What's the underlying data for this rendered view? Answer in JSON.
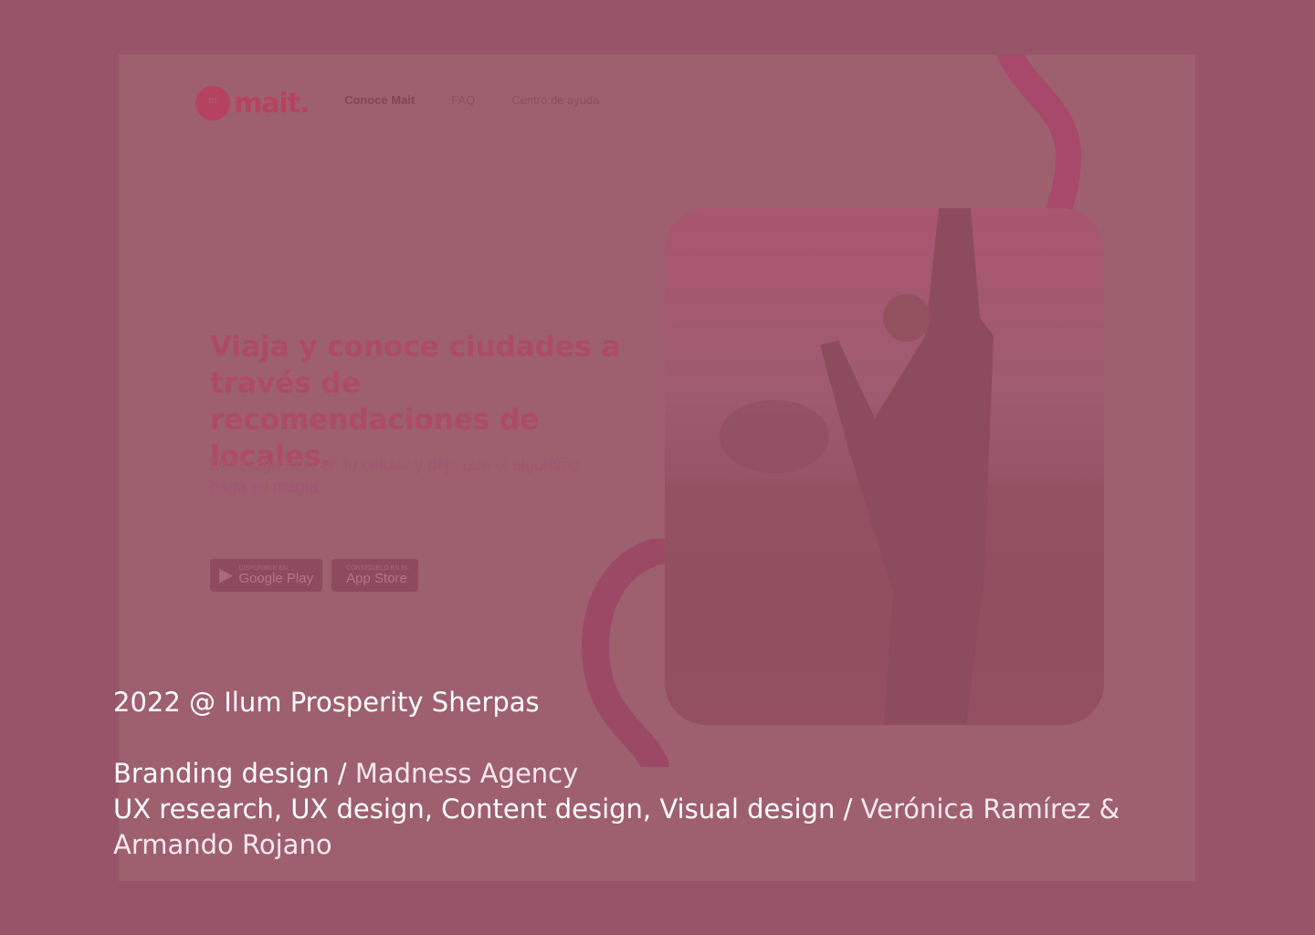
{
  "mockup": {
    "logo_text": "mait.",
    "logo_mark_icon": "mait-logo-icon",
    "nav": [
      {
        "label": "Conoce Mait",
        "active": true
      },
      {
        "label": "FAQ",
        "active": false
      },
      {
        "label": "Centro de ayuda",
        "active": false
      }
    ],
    "hero_title": "Viaja y conoce ciudades a través de recomendaciones de locales.",
    "hero_subtitle": "Descarga Mait en tu celular y deja que el algoritmo haga su magia.",
    "store_buttons": [
      {
        "small": "Disponible en",
        "big": "Google Play",
        "icon": "google-play-icon"
      },
      {
        "small": "Consíguelo en el",
        "big": "App Store",
        "icon": "apple-icon"
      }
    ],
    "photo_description_icon": "hero-photo"
  },
  "credits": {
    "year_line": "2022 @ Ilum Prosperity Sherpas",
    "branding_role": "Branding design / ",
    "branding_name": "Madness Agency",
    "ux_role": "UX research, UX design, Content design, Visual design / ",
    "ux_name": "Verónica Ramírez & Armando Rojano"
  },
  "colors": {
    "background": "#985569",
    "brand_accent": "#b5435f"
  }
}
